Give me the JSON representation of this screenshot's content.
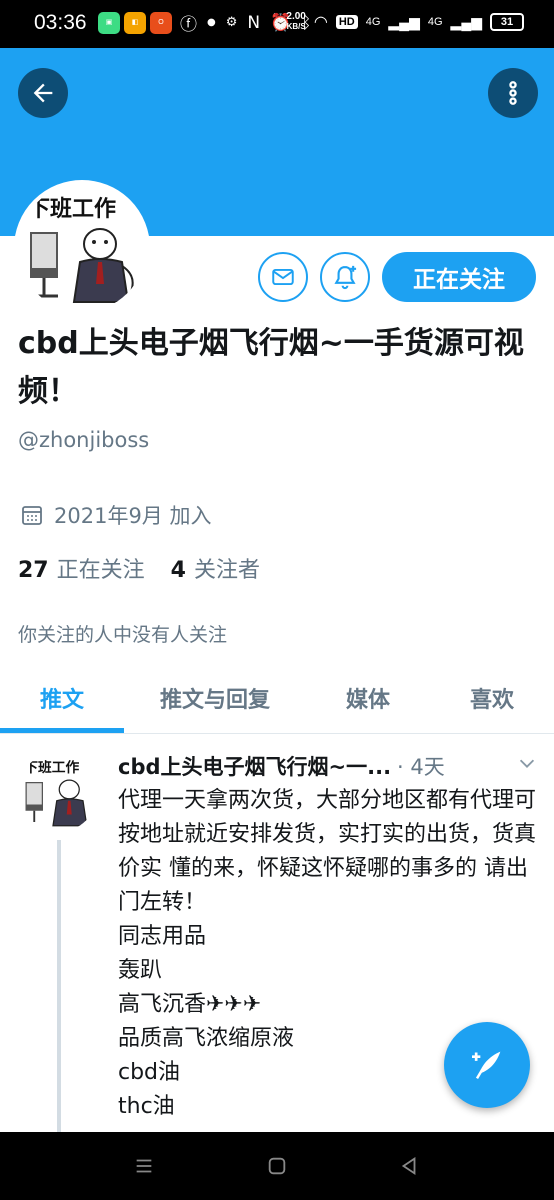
{
  "status_bar": {
    "time": "03:36",
    "network_speed_value": "2.00",
    "network_speed_unit": "KB/S",
    "battery": "31",
    "signal_1": "4G",
    "signal_2": "4G"
  },
  "profile": {
    "name": "cbd上头电子烟飞行烟~一手货源可视频！",
    "handle": "@zhonjiboss",
    "joined": "2021年9月 加入",
    "following_count": "27",
    "following_label": "正在关注",
    "followers_count": "4",
    "followers_label": "关注者",
    "mutual_note": "你关注的人中没有人关注",
    "follow_button": "正在关注"
  },
  "tabs": [
    {
      "label": "推文",
      "active": true
    },
    {
      "label": "推文与回复",
      "active": false
    },
    {
      "label": "媒体",
      "active": false
    },
    {
      "label": "喜欢",
      "active": false
    }
  ],
  "tweet": {
    "author": "cbd上头电子烟飞行烟~一...",
    "time": "· 4天",
    "lines": [
      "代理一天拿两次货，大部分地区都有代理可按地址就近安排发货，实打实的出货，货真价实 懂的来，怀疑这怀疑哪的事多的 请出门左转！",
      "同志用品",
      "轰趴",
      "高飞沉香✈✈✈",
      "品质高飞浓缩原液",
      "cbd油",
      "thc油"
    ]
  },
  "colors": {
    "brand": "#1da1f2",
    "banner": "#1da1f2",
    "muted_text": "#657786"
  },
  "icons": {
    "back": "arrow-left-icon",
    "more": "more-vertical-icon",
    "mail": "mail-icon",
    "bell": "bell-plus-icon",
    "calendar": "calendar-icon",
    "chevron": "chevron-down-icon",
    "compose": "compose-feather-icon"
  }
}
